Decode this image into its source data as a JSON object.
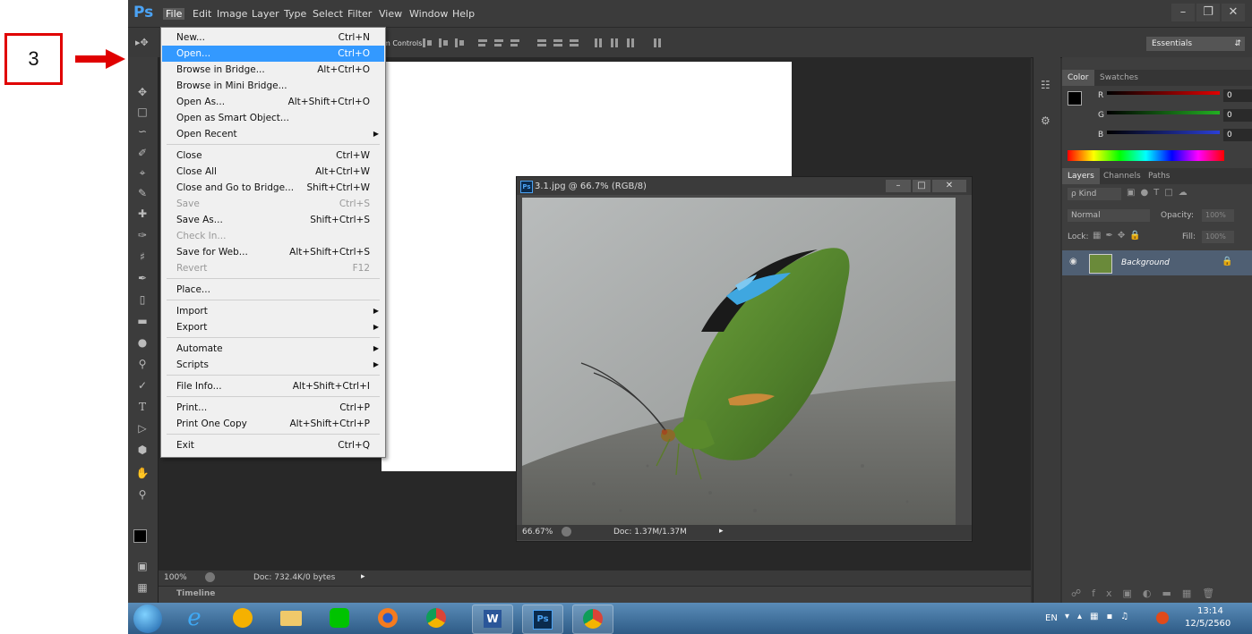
{
  "annotation": {
    "step_number": "3",
    "box_color": "#e00000",
    "arrow_color": "#e00000"
  },
  "app": {
    "logo": "Ps"
  },
  "menubar": {
    "items": [
      "File",
      "Edit",
      "Image",
      "Layer",
      "Type",
      "Select",
      "Filter",
      "View",
      "Window",
      "Help"
    ]
  },
  "window_controls": {
    "minimize": "–",
    "restore": "❐",
    "close": "✕"
  },
  "options_bar": {
    "controls_label": "m Controls",
    "workspace": "Essentials"
  },
  "file_menu": {
    "items": [
      {
        "label": "New...",
        "shortcut": "Ctrl+N"
      },
      {
        "label": "Open...",
        "shortcut": "Ctrl+O",
        "highlighted": true
      },
      {
        "label": "Browse in Bridge...",
        "shortcut": "Alt+Ctrl+O"
      },
      {
        "label": "Browse in Mini Bridge...",
        "shortcut": ""
      },
      {
        "label": "Open As...",
        "shortcut": "Alt+Shift+Ctrl+O"
      },
      {
        "label": "Open as Smart Object...",
        "shortcut": ""
      },
      {
        "label": "Open Recent",
        "shortcut": "",
        "submenu": true
      },
      {
        "label": "Close",
        "shortcut": "Ctrl+W"
      },
      {
        "label": "Close All",
        "shortcut": "Alt+Ctrl+W"
      },
      {
        "label": "Close and Go to Bridge...",
        "shortcut": "Shift+Ctrl+W"
      },
      {
        "label": "Save",
        "shortcut": "Ctrl+S",
        "disabled": true
      },
      {
        "label": "Save As...",
        "shortcut": "Shift+Ctrl+S"
      },
      {
        "label": "Check In...",
        "shortcut": "",
        "disabled": true
      },
      {
        "label": "Save for Web...",
        "shortcut": "Alt+Shift+Ctrl+S"
      },
      {
        "label": "Revert",
        "shortcut": "F12",
        "disabled": true
      },
      {
        "label": "Place...",
        "shortcut": ""
      },
      {
        "label": "Import",
        "shortcut": "",
        "submenu": true
      },
      {
        "label": "Export",
        "shortcut": "",
        "submenu": true
      },
      {
        "label": "Automate",
        "shortcut": "",
        "submenu": true
      },
      {
        "label": "Scripts",
        "shortcut": "",
        "submenu": true
      },
      {
        "label": "File Info...",
        "shortcut": "Alt+Shift+Ctrl+I"
      },
      {
        "label": "Print...",
        "shortcut": "Ctrl+P"
      },
      {
        "label": "Print One Copy",
        "shortcut": "Alt+Shift+Ctrl+P"
      },
      {
        "label": "Exit",
        "shortcut": "Ctrl+Q"
      }
    ]
  },
  "document": {
    "status_zoom": "100%",
    "status_doc": "Doc: 732.4K/0 bytes",
    "timeline_label": "Timeline"
  },
  "image_window": {
    "badge": "Ps",
    "title": "3.1.jpg @ 66.7% (RGB/8)",
    "zoom": "66.67%",
    "doc_size": "Doc: 1.37M/1.37M"
  },
  "color_panel": {
    "tabs": [
      "Color",
      "Swatches"
    ],
    "channels": [
      {
        "name": "R",
        "value": "0",
        "color": "#e00000"
      },
      {
        "name": "G",
        "value": "0",
        "color": "#22b022"
      },
      {
        "name": "B",
        "value": "0",
        "color": "#2b3fd6"
      }
    ]
  },
  "layers_panel": {
    "tabs": [
      "Layers",
      "Channels",
      "Paths"
    ],
    "kind_label": "ρ Kind",
    "blend_mode": "Normal",
    "opacity_label": "Opacity:",
    "opacity_value": "100%",
    "lock_label": "Lock:",
    "fill_label": "Fill:",
    "fill_value": "100%",
    "layer_name": "Background"
  },
  "taskbar": {
    "lang": "EN",
    "time": "13:14",
    "date": "12/5/2560"
  }
}
